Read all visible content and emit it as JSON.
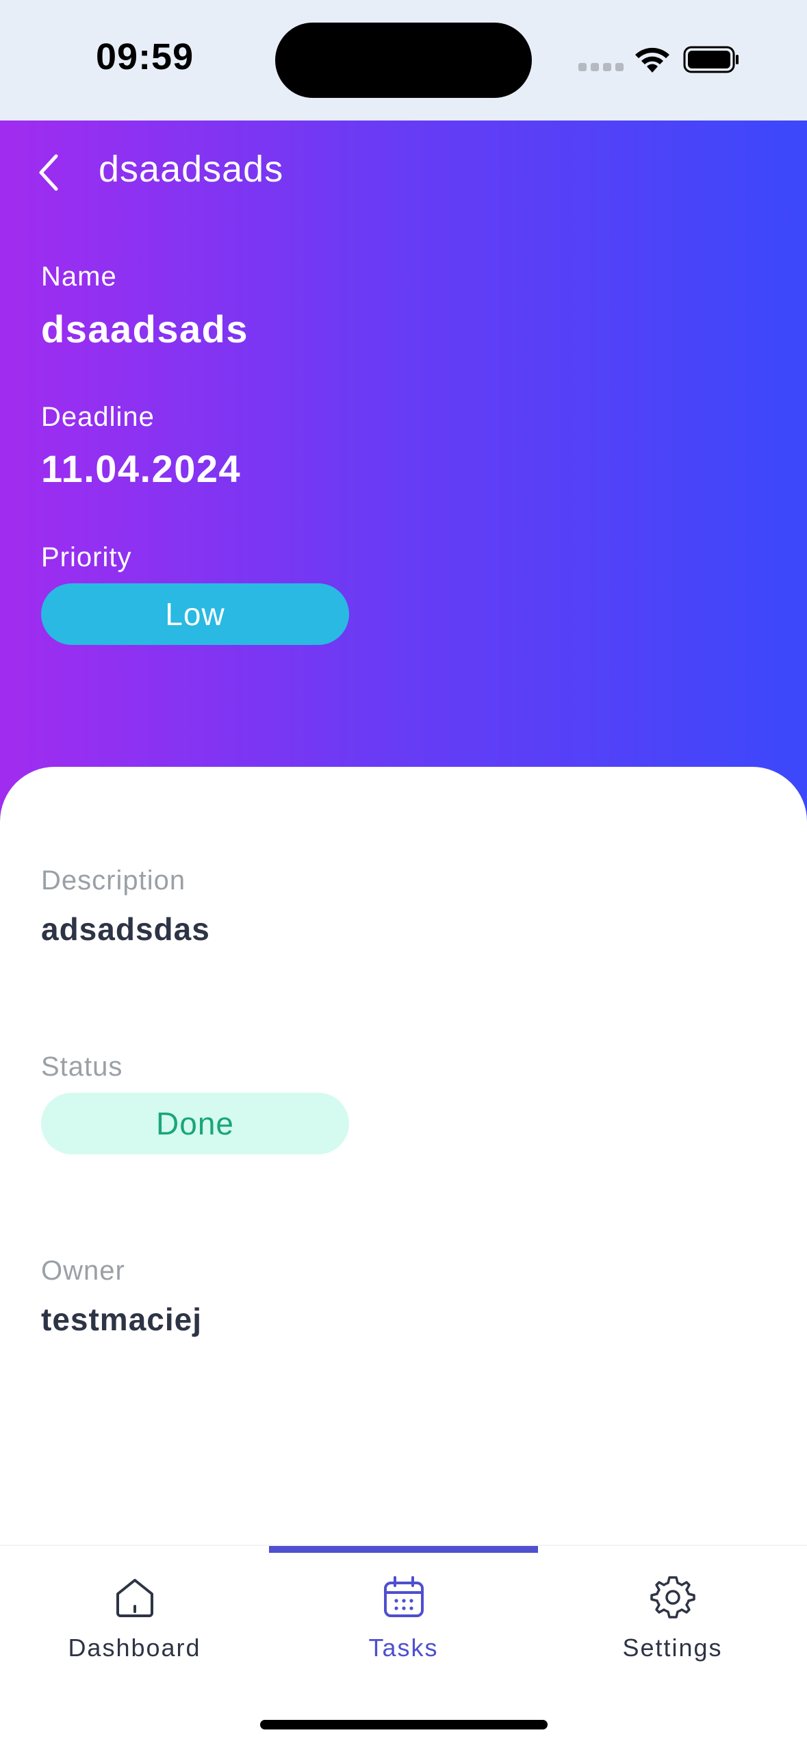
{
  "status_bar": {
    "time": "09:59"
  },
  "header": {
    "title": "dsaadsads"
  },
  "task": {
    "name_label": "Name",
    "name": "dsaadsads",
    "deadline_label": "Deadline",
    "deadline": "11.04.2024",
    "priority_label": "Priority",
    "priority": "Low",
    "description_label": "Description",
    "description": "adsadsdas",
    "status_label": "Status",
    "status": "Done",
    "owner_label": "Owner",
    "owner": "testmaciej"
  },
  "tabs": [
    {
      "label": "Dashboard",
      "icon": "home-icon",
      "active": false
    },
    {
      "label": "Tasks",
      "icon": "calendar-icon",
      "active": true
    },
    {
      "label": "Settings",
      "icon": "gear-icon",
      "active": false
    }
  ],
  "colors": {
    "gradient_start": "#a12cf0",
    "gradient_end": "#3c48fb",
    "priority_pill": "#29b9e2",
    "status_pill_bg": "#d5fbf0",
    "status_pill_text": "#1aa57b",
    "accent": "#4f4fcf"
  }
}
